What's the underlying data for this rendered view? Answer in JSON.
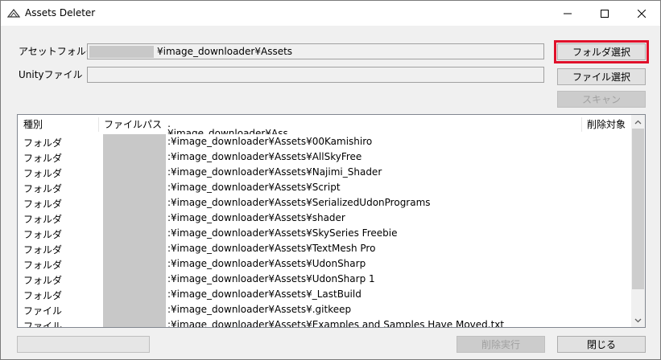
{
  "window": {
    "title": "Assets Deleter",
    "controls": {
      "minimize": "minimize-icon",
      "maximize": "maximize-icon",
      "close": "close-icon"
    }
  },
  "form": {
    "asset_folder_label": "アセットフォルダ",
    "asset_folder_value": "¥image_downloader¥Assets",
    "unity_file_label": "Unityファイル",
    "unity_file_value": "",
    "folder_select_button": "フォルダ選択",
    "file_select_button": "ファイル選択",
    "scan_button": "スキャン"
  },
  "grid": {
    "columns": [
      "種別",
      "ファイルパス",
      "削除対象"
    ],
    "partial_row_text": ":¥image_downloader¥Assets",
    "rows": [
      {
        "type": "フォルダ",
        "path": ":¥image_downloader¥Assets¥00Kamishiro"
      },
      {
        "type": "フォルダ",
        "path": ":¥image_downloader¥Assets¥AllSkyFree"
      },
      {
        "type": "フォルダ",
        "path": ":¥image_downloader¥Assets¥Najimi_Shader"
      },
      {
        "type": "フォルダ",
        "path": ":¥image_downloader¥Assets¥Script"
      },
      {
        "type": "フォルダ",
        "path": ":¥image_downloader¥Assets¥SerializedUdonPrograms"
      },
      {
        "type": "フォルダ",
        "path": ":¥image_downloader¥Assets¥shader"
      },
      {
        "type": "フォルダ",
        "path": ":¥image_downloader¥Assets¥SkySeries Freebie"
      },
      {
        "type": "フォルダ",
        "path": ":¥image_downloader¥Assets¥TextMesh Pro"
      },
      {
        "type": "フォルダ",
        "path": ":¥image_downloader¥Assets¥UdonSharp"
      },
      {
        "type": "フォルダ",
        "path": ":¥image_downloader¥Assets¥UdonSharp 1"
      },
      {
        "type": "フォルダ",
        "path": ":¥image_downloader¥Assets¥_LastBuild"
      },
      {
        "type": "ファイル",
        "path": ":¥image_downloader¥Assets¥.gitkeep"
      },
      {
        "type": "ファイル",
        "path": ":¥image_downloader¥Assets¥Examples and Samples Have Moved.txt"
      }
    ]
  },
  "footer": {
    "delete_button": "削除実行",
    "close_button": "閉じる"
  },
  "colors": {
    "highlight": "#e0102a",
    "redaction": "#c8c8c8"
  }
}
